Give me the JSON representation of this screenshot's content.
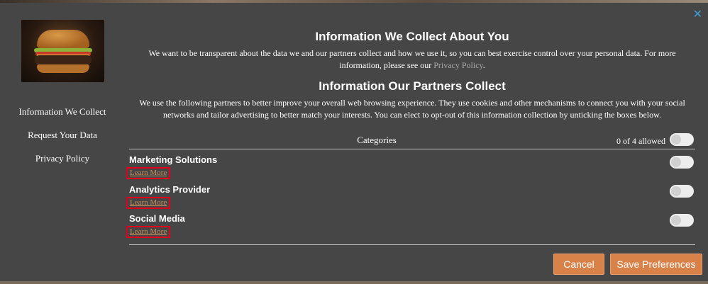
{
  "close_label": "✕",
  "sidebar": {
    "image_alt": "burger",
    "items": [
      {
        "label": "Information We Collect"
      },
      {
        "label": "Request Your Data"
      },
      {
        "label": "Privacy Policy"
      }
    ]
  },
  "section1": {
    "title": "Information We Collect About You",
    "text": "We want to be transparent about the data we and our partners collect and how we use it, so you can best exercise control over your personal data. For more information, please see our",
    "link": "Privacy Policy",
    "after": "."
  },
  "section2": {
    "title": "Information Our Partners Collect",
    "text": "We use the following partners to better improve your overall web browsing experience. They use cookies and other mechanisms to connect you with your social networks and tailor advertising to better match your interests. You can elect to opt-out of this information collection by unticking the boxes below."
  },
  "categories": {
    "header": "Categories",
    "allowed": "0 of 4 allowed",
    "items": [
      {
        "name": "Marketing Solutions",
        "learn_more": "Learn More"
      },
      {
        "name": "Analytics Provider",
        "learn_more": "Learn More"
      },
      {
        "name": "Social Media",
        "learn_more": "Learn More"
      }
    ]
  },
  "buttons": {
    "cancel": "Cancel",
    "save": "Save Preferences"
  }
}
